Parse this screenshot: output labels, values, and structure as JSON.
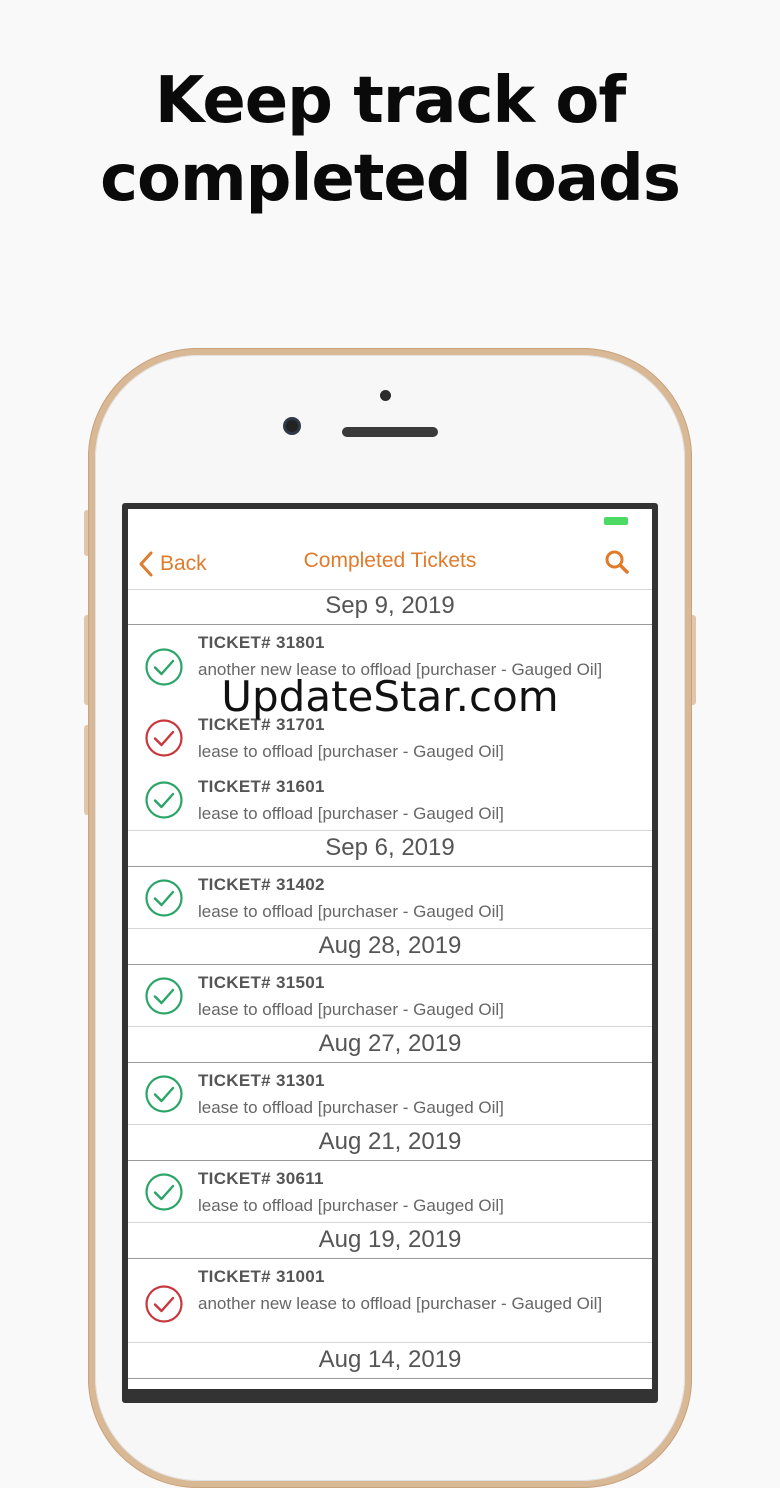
{
  "headline": {
    "line1": "Keep track of",
    "line2": "completed loads"
  },
  "navbar": {
    "back_label": "Back",
    "title": "Completed Tickets"
  },
  "watermark": "UpdateStar.com",
  "colors": {
    "accent": "#e07b2c",
    "success": "#2aa567",
    "error": "#c8373b",
    "battery": "#4cd964"
  },
  "groups": [
    {
      "date": "Sep 9, 2019",
      "tickets": [
        {
          "ticket": "TICKET# 31801",
          "desc": "another new lease to offload [purchaser - Gauged Oil]",
          "status": "ok"
        },
        {
          "ticket": "TICKET# 31701",
          "desc": "lease to offload [purchaser - Gauged Oil]",
          "status": "error"
        },
        {
          "ticket": "TICKET# 31601",
          "desc": "lease to offload [purchaser - Gauged Oil]",
          "status": "ok"
        }
      ]
    },
    {
      "date": "Sep 6, 2019",
      "tickets": [
        {
          "ticket": "TICKET# 31402",
          "desc": "lease to offload [purchaser - Gauged Oil]",
          "status": "ok"
        }
      ]
    },
    {
      "date": "Aug 28, 2019",
      "tickets": [
        {
          "ticket": "TICKET# 31501",
          "desc": "lease to offload [purchaser - Gauged Oil]",
          "status": "ok"
        }
      ]
    },
    {
      "date": "Aug 27, 2019",
      "tickets": [
        {
          "ticket": "TICKET# 31301",
          "desc": "lease to offload [purchaser - Gauged Oil]",
          "status": "ok"
        }
      ]
    },
    {
      "date": "Aug 21, 2019",
      "tickets": [
        {
          "ticket": "TICKET# 30611",
          "desc": "lease to offload [purchaser - Gauged Oil]",
          "status": "ok"
        }
      ]
    },
    {
      "date": "Aug 19, 2019",
      "tickets": [
        {
          "ticket": "TICKET# 31001",
          "desc": "another new lease to offload [purchaser - Gauged Oil]",
          "status": "error"
        }
      ]
    },
    {
      "date": "Aug 14, 2019",
      "tickets": []
    }
  ]
}
